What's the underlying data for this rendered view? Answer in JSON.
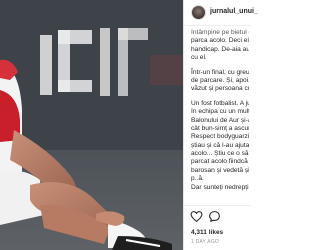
{
  "post": {
    "username": "jurnalul_unui_",
    "caption_lines": [
      "întâmpine pe bietul om",
      "parca acolo. Deci ei știau",
      "handicap. De-aia au și lăsat",
      "cu el.",
      "",
      "Într-un final, cu greu, a reușit",
      "de parcare. Și, apoi, cu mare",
      "văzut și persoana cu handicap",
      "",
      "Un fost fotbalist. A jucat",
      "în echipa cu un multiplu",
      "Balonului de Aur și-a ",
      "cât bun-simț a ascuns",
      "Respect bodyguarzilor",
      "știau și că l-au ajutat să",
      "acolo... Știu ce o să spun",
      "parcat acolo fiindcă o ",
      "barosan și vedetă și dă",
      "p..ă.",
      "Dar sunteți nedrepți. Ușor"
    ],
    "likes": "4,311 likes",
    "time_ago": "1 DAY AGO"
  }
}
